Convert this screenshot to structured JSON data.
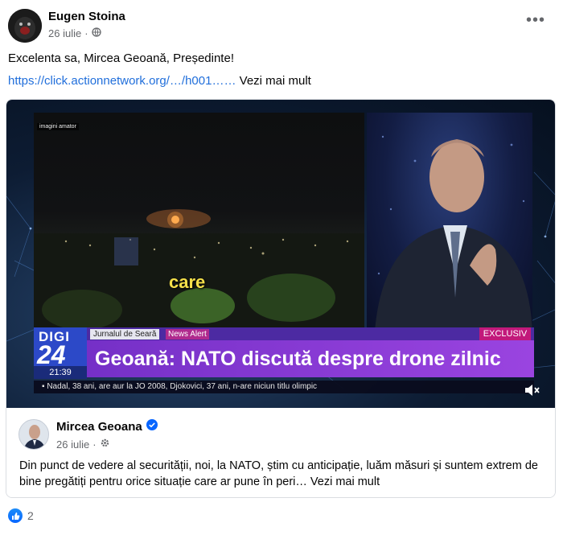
{
  "post": {
    "author": "Eugen Stoina",
    "date": "26 iulie",
    "dot": "·",
    "text": "Excelenta sa, Mircea Geoană, Președinte!",
    "link": "https://click.actionnetwork.org/…/h001……",
    "see_more": " Vezi mai mult"
  },
  "video": {
    "amateur_label": "imagini amator",
    "caption": "care",
    "channel_logo_top": "DIGI",
    "channel_logo_num": "24",
    "time": "21:39",
    "show_tag": "Jurnalul de Seară",
    "alert_tag": "News Alert",
    "exclusive_tag": "EXCLUSIV",
    "headline": "Geoană: NATO discută despre drone zilnic",
    "ticker": "Nadal, 38 ani, are aur la JO 2008, Djokovici, 37 ani, n-are niciun titlu olimpic"
  },
  "shared": {
    "author": "Mircea Geoana",
    "date": "26 iulie",
    "dot": "·",
    "text": "Din punct de vedere al securității, noi, la NATO, știm cu anticipație, luăm măsuri și suntem extrem de bine pregătiți pentru orice situație care ar pune în peri…",
    "see_more": " Vezi mai mult"
  },
  "reactions": {
    "count": "2"
  },
  "colors": {
    "link": "#216fdb",
    "secondary_text": "#65676b",
    "verified": "#0866ff"
  },
  "icons": {
    "audience": "globe-icon",
    "shared_audience": "gear-icon",
    "verified": "verified-badge-icon",
    "more": "more-options-icon",
    "like": "like-icon",
    "volume": "muted-speaker-icon"
  }
}
